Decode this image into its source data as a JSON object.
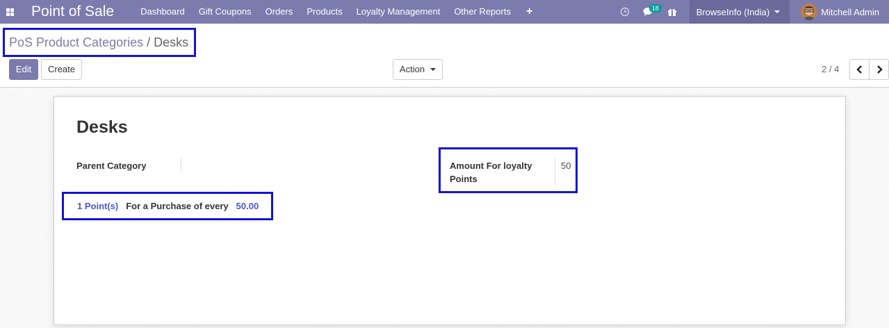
{
  "navbar": {
    "app_title": "Point of Sale",
    "menu": [
      "Dashboard",
      "Gift Coupons",
      "Orders",
      "Products",
      "Loyalty Management",
      "Other Reports"
    ],
    "plus_label": "+",
    "messages_badge": "18",
    "company": "BrowseInfo (India)",
    "user": "Mitchell Admin",
    "color": "#7c7bad"
  },
  "breadcrumb": {
    "parent": "PoS Product Categories",
    "separator": "/",
    "current": "Desks"
  },
  "toolbar": {
    "edit_label": "Edit",
    "create_label": "Create",
    "action_label": "Action",
    "pager": "2 / 4"
  },
  "form": {
    "title": "Desks",
    "parent_category_label": "Parent Category",
    "parent_category_value": "",
    "loyalty_amount_label": "Amount For loyalty Points",
    "loyalty_amount_value": "50",
    "points_label": "1 Point(s)",
    "purchase_text": "For a Purchase of every",
    "purchase_amount": "50.00"
  },
  "icons": [
    "apps-icon",
    "clock-icon",
    "chat-icon",
    "gift-icon",
    "caret-down-icon",
    "chevron-left-icon",
    "chevron-right-icon"
  ],
  "highlight_color": "#1411d9",
  "link_color": "#4a56d6"
}
